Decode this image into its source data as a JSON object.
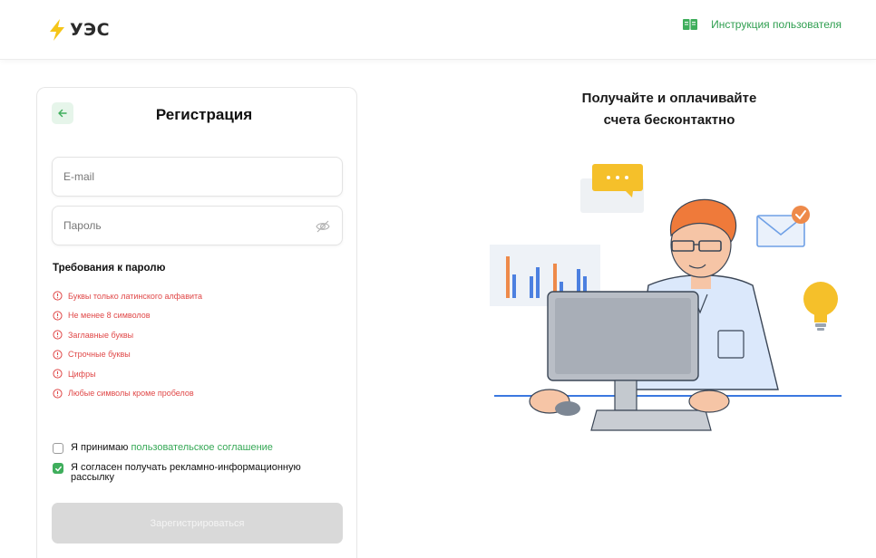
{
  "header": {
    "logo_text": "УЭС",
    "guide_link": "Инструкция пользователя"
  },
  "form": {
    "title": "Регистрация",
    "email": {
      "placeholder": "E-mail",
      "value": ""
    },
    "password": {
      "placeholder": "Пароль",
      "value": ""
    },
    "requirements_title": "Требования к паролю",
    "requirements": [
      "Буквы только латинского алфавита",
      "Не менее 8 символов",
      "Заглавные буквы",
      "Строчные буквы",
      "Цифры",
      "Любые символы кроме пробелов"
    ],
    "agreement": {
      "prefix": "Я принимаю",
      "link": "пользовательское соглашение",
      "checked": false
    },
    "newsletter": {
      "label": "Я согласен получать рекламно-информационную рассылку",
      "checked": true
    },
    "submit_label": "Зарегистрироваться"
  },
  "promo": {
    "line1": "Получайте и оплачивайте",
    "line2": "счета бесконтактно"
  },
  "colors": {
    "brand_green": "#2e9e4f",
    "error_red": "#e04848",
    "logo_yellow": "#f5c518"
  }
}
